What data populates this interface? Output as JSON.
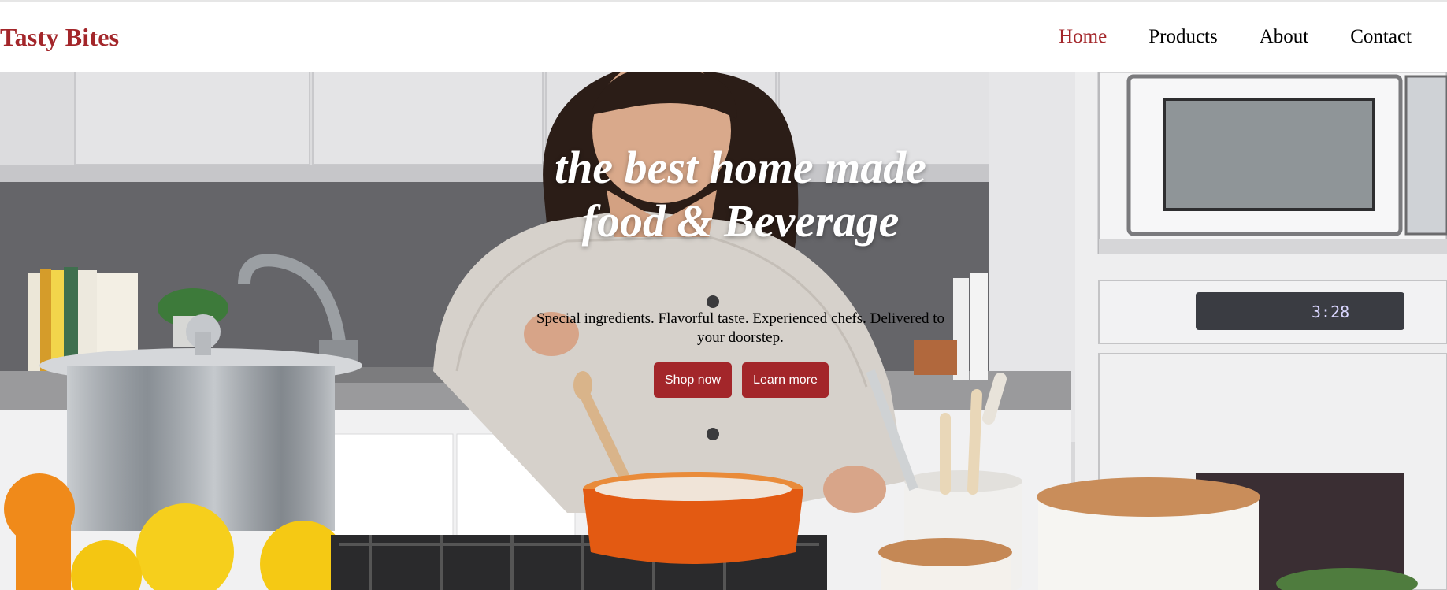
{
  "brand": {
    "name": "Tasty Bites"
  },
  "nav": {
    "items": [
      {
        "label": "Home",
        "active": true
      },
      {
        "label": "Products",
        "active": false
      },
      {
        "label": "About",
        "active": false
      },
      {
        "label": "Contact",
        "active": false
      }
    ]
  },
  "hero": {
    "title_line1": "the best home made",
    "title_line2": "food & Beverage",
    "subtitle": "Special ingredients. Flavorful taste. Experienced chefs. Delivered to your doorstep.",
    "primary_button": "Shop now",
    "secondary_button": "Learn more",
    "oven_display": "3:28"
  },
  "colors": {
    "brand_red": "#a3262a",
    "nav_text": "#000000",
    "hero_title": "#ffffff",
    "button_bg": "#a3262a",
    "button_text": "#ffffff"
  }
}
